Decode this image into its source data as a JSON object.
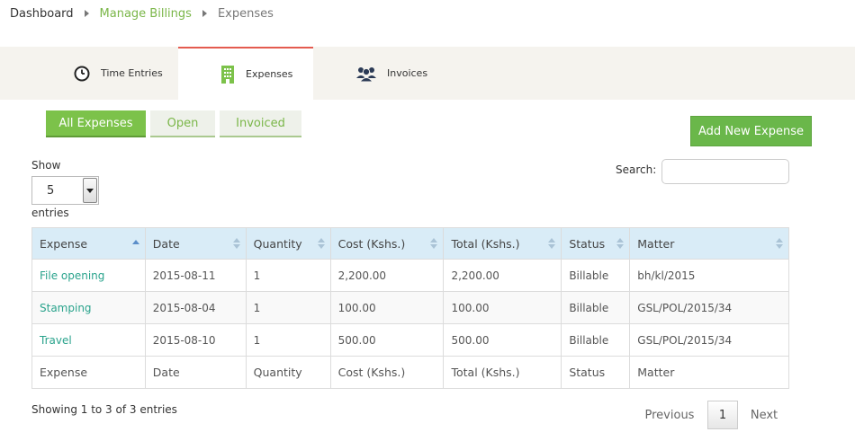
{
  "breadcrumb": {
    "home": "Dashboard",
    "link": "Manage Billings",
    "current": "Expenses"
  },
  "tabs": [
    {
      "label": "Time Entries",
      "icon": "clock-icon"
    },
    {
      "label": "Expenses",
      "icon": "building-icon"
    },
    {
      "label": "Invoices",
      "icon": "users-icon"
    }
  ],
  "subtabs": [
    {
      "label": "All Expenses"
    },
    {
      "label": "Open"
    },
    {
      "label": "Invoiced"
    }
  ],
  "actions": {
    "add_label": "Add New Expense"
  },
  "length": {
    "show_label": "Show",
    "value": "5",
    "entries_label": "entries"
  },
  "search": {
    "label": "Search:",
    "value": ""
  },
  "table": {
    "columns": [
      "Expense",
      "Date",
      "Quantity",
      "Cost (Kshs.)",
      "Total (Kshs.)",
      "Status",
      "Matter"
    ],
    "rows": [
      [
        "File opening",
        "2015-08-11",
        "1",
        "2,200.00",
        "2,200.00",
        "Billable",
        "bh/kl/2015"
      ],
      [
        "Stamping",
        "2015-08-04",
        "1",
        "100.00",
        "100.00",
        "Billable",
        "GSL/POL/2015/34"
      ],
      [
        "Travel",
        "2015-08-10",
        "1",
        "500.00",
        "500.00",
        "Billable",
        "GSL/POL/2015/34"
      ]
    ]
  },
  "info": "Showing 1 to 3 of 3 entries",
  "pagination": {
    "previous": "Previous",
    "current": "1",
    "next": "Next"
  },
  "colors": {
    "accent_green": "#7cc24a",
    "link_teal": "#2aa38c",
    "active_tab_border": "#e45b50",
    "header_blue": "#d9ecf7"
  }
}
